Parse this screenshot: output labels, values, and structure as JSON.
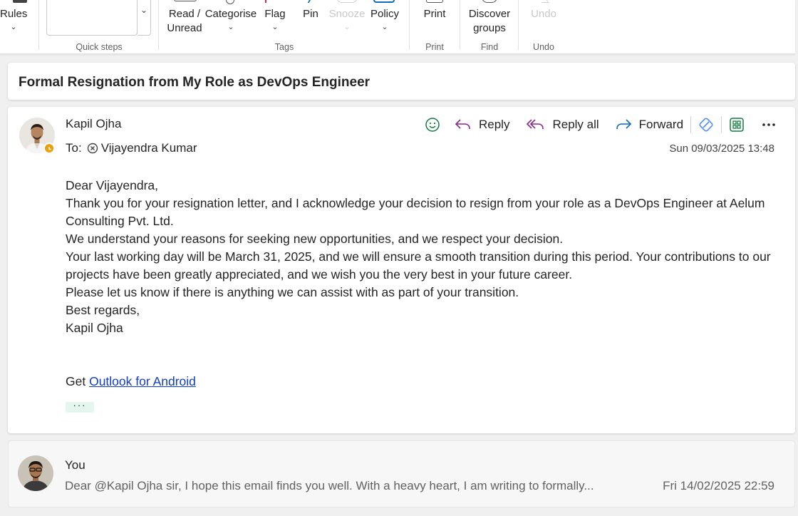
{
  "ribbon": {
    "rules": "Rules",
    "quick_steps_label": "Quick steps",
    "read_unread_line1": "Read /",
    "read_unread_line2": "Unread",
    "categorise": "Categorise",
    "flag": "Flag",
    "pin": "Pin",
    "snooze": "Snooze",
    "policy": "Policy",
    "tags_label": "Tags",
    "print": "Print",
    "print_label": "Print",
    "discover_line1": "Discover",
    "discover_line2": "groups",
    "find_label": "Find",
    "undo": "Undo",
    "undo_label": "Undo"
  },
  "subject": "Formal Resignation from My Role as DevOps Engineer",
  "message": {
    "sender": "Kapil Ojha",
    "to_label": "To:",
    "recipient": "Vijayendra Kumar",
    "date": "Sun 09/03/2025 13:48",
    "actions": {
      "reply": "Reply",
      "reply_all": "Reply all",
      "forward": "Forward"
    },
    "body": {
      "greeting": "Dear Vijayendra,",
      "p1": "Thank you for your resignation letter, and I acknowledge your decision to resign from your role as a DevOps Engineer at Aelum Consulting Pvt. Ltd.",
      "p2": "We understand your reasons for seeking new opportunities, and we respect your decision.",
      "p3": "Your last working day will be March 31, 2025, and we will ensure a smooth transition during this period. Your contributions to our projects have been greatly appreciated, and we wish you the very best in your future career.",
      "p4": "Please let us know if there is anything we can assist with as part of your transition.",
      "closing": "Best regards,",
      "signature": "Kapil Ojha",
      "get_prefix": "Get ",
      "link": "Outlook for Android"
    },
    "more_dots": "···"
  },
  "previous": {
    "sender": "You",
    "snippet": "Dear @Kapil Ojha sir, I hope this email finds you well. With a heavy heart, I am writing to formally...",
    "date": "Fri 14/02/2025 22:59"
  },
  "colors": {
    "accent_purple": "#8b2b8f",
    "accent_blue": "#0f6cbd",
    "accent_green": "#107c41",
    "presence_away": "#e8a10c"
  }
}
